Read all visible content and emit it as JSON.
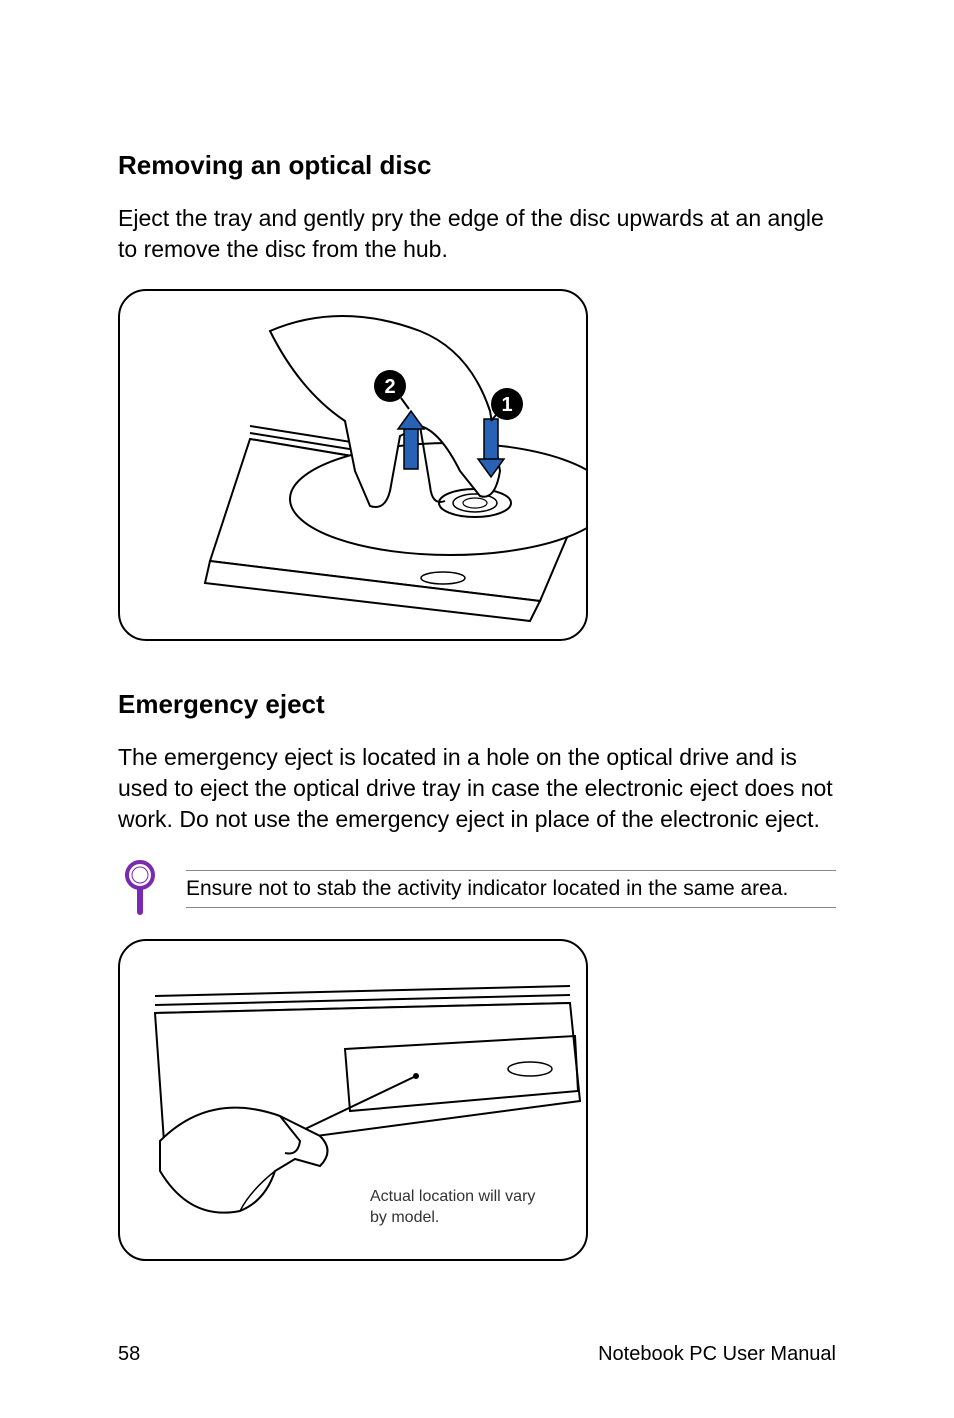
{
  "section1": {
    "heading": "Removing an optical disc",
    "body": "Eject the tray and gently pry the edge of the disc upwards at an angle to remove the disc from the hub."
  },
  "fig1": {
    "callout1": "1",
    "callout2": "2"
  },
  "section2": {
    "heading": "Emergency eject",
    "body": "The emergency eject is located in a hole on the optical drive and is used to eject the optical drive tray in case the electronic eject does not work. Do not use the emergency eject in place of the electronic eject."
  },
  "note": {
    "text": "Ensure not to stab the activity indicator located in the same area."
  },
  "fig2": {
    "caption": "Actual location will vary by model."
  },
  "footer": {
    "page": "58",
    "title": "Notebook PC User Manual"
  }
}
